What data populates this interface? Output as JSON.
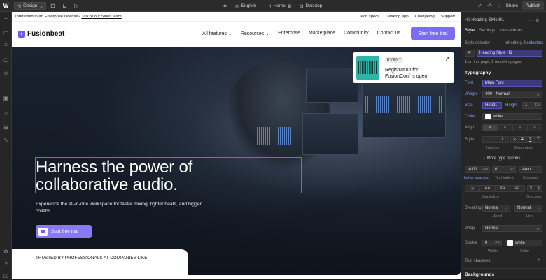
{
  "topbar": {
    "mode_label": "Design",
    "language": "English",
    "page": "Home",
    "breakpoint": "Desktop",
    "share": "Share",
    "publish": "Publish"
  },
  "site": {
    "notice_text": "Interested in an Enterprise License?",
    "notice_link": "Talk to our Sales team",
    "notice_end": ".",
    "notice_links": [
      "Tech specs",
      "Desktop app",
      "Changelog",
      "Support"
    ],
    "logo": "Fusionbeat",
    "nav": [
      "All features",
      "Resources",
      "Enterprise",
      "Marketplace",
      "Community",
      "Contact us"
    ],
    "nav_cta": "Start free trial",
    "headline_line1": "Harness the power of",
    "headline_line2": "collaborative audio.",
    "subtext": "Experience the all-in-one workspace for faster mixing, tighter beats, and bigger collabs.",
    "hero_cta": "Start free trial",
    "event_tag": "EVENT",
    "event_text": "Registration for FusionConf is open",
    "trusted": "TRUSTED BY PROFESSIONALS AT COMPANIES LIKE"
  },
  "panel": {
    "element_title": "Heading Style H1",
    "tabs": [
      "Style",
      "Settings",
      "Interactions"
    ],
    "style_selector_label": "Style selector",
    "inheriting": "Inheriting",
    "inheriting_count": "2 selectors",
    "selector_value": "Heading Style H1",
    "usage_note": "1 on this page, 1 on other pages.",
    "typography": "Typography",
    "font_label": "Font",
    "font_value": "Main Font",
    "weight_label": "Weight",
    "weight_value": "400 - Normal",
    "size_label": "Size",
    "size_value": "Head...",
    "height_label": "Height",
    "height_value": "1",
    "height_unit": "EM",
    "color_label": "Color",
    "color_value": "white",
    "align_label": "Align",
    "style_label": "Style",
    "italicize": "Italicize",
    "decoration": "Decoration",
    "more_type": "More type options",
    "letter_spacing_value": "-0.01",
    "letter_spacing_unit": "EM",
    "text_indent_value": "0",
    "text_indent_unit": "PX",
    "columns_value": "Auto",
    "letter_spacing": "Letter spacing",
    "text_indent": "Text indent",
    "columns": "Columns",
    "capitalize": "Capitalize",
    "direction": "Direction",
    "breaking_label": "Breaking",
    "word_value": "Normal",
    "line_value": "Normal",
    "word": "Word",
    "line": "Line",
    "wrap_label": "Wrap",
    "wrap_value": "Normal",
    "stroke_label": "Stroke",
    "stroke_width": "0",
    "stroke_unit": "PX",
    "stroke_color": "white",
    "width_cap": "Width",
    "color_cap": "Color",
    "text_shadows": "Text shadows",
    "backgrounds": "Backgrounds",
    "case_options": [
      "Aa",
      "Aa",
      "aa"
    ]
  },
  "colors": {
    "accent": "#7b6cf6",
    "selection": "#5a6ef0",
    "panel_bg": "#262626"
  }
}
